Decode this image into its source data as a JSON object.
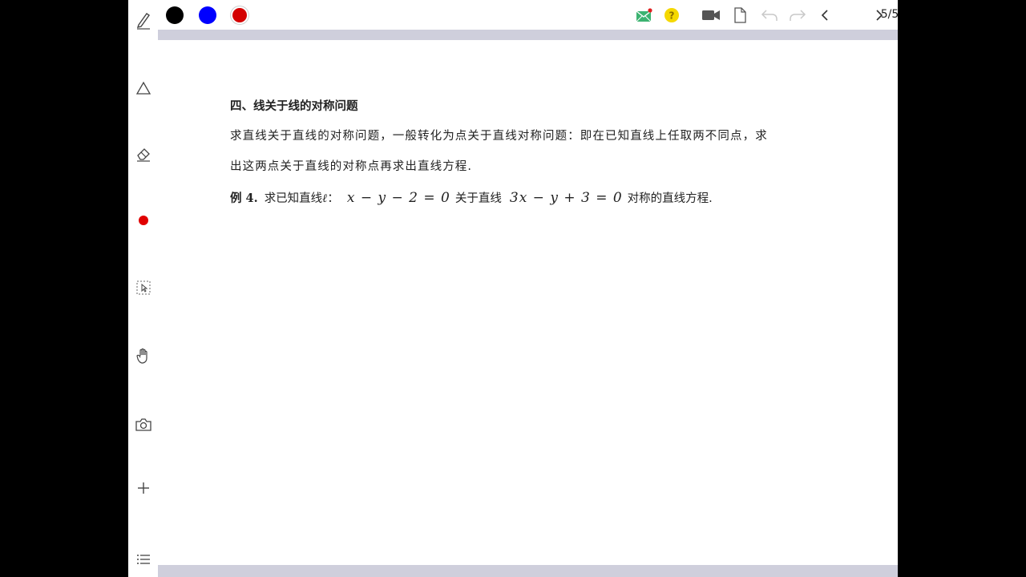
{
  "toolbar": {
    "colors": [
      "#000000",
      "#0000ff",
      "#d40000"
    ],
    "selected_color": "#d40000",
    "icons": [
      "mail-icon",
      "help-icon",
      "video-icon",
      "document-icon",
      "undo-icon",
      "redo-icon",
      "prev-page-icon",
      "next-page-icon"
    ],
    "page_indicator": "5/5"
  },
  "left_tools": [
    "pen-icon",
    "shape-icon",
    "eraser-icon",
    "color-dot-icon",
    "select-icon",
    "hand-icon",
    "camera-icon",
    "add-icon",
    "menu-icon"
  ],
  "document": {
    "heading": "四、线关于线的对称问题",
    "para1": "求直线关于直线的对称问题，一般转化为点关于直线对称问题：即在已知直线上任取两不同点，求",
    "para2": "出这两点关于直线的对称点再求出直线方程.",
    "example": {
      "label": "例 4.",
      "text1": "求已知直线",
      "line_name": "ℓ",
      "colon": "：",
      "eq1": "x − y − 2 = 0",
      "text2": "关于直线",
      "eq2": "3x − y + 3 = 0",
      "text3": "对称的直线方程."
    }
  }
}
